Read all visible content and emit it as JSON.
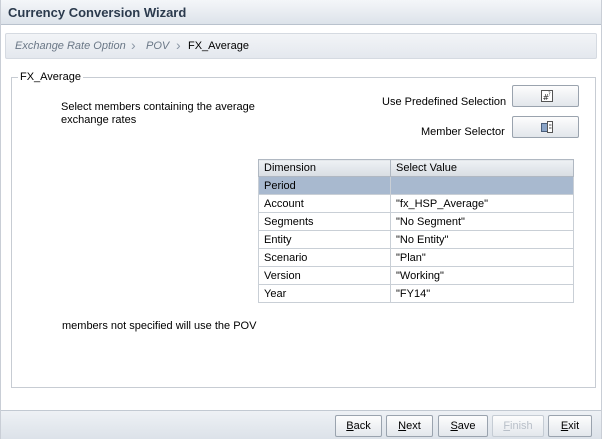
{
  "window": {
    "title": "Currency Conversion Wizard"
  },
  "breadcrumb": {
    "items": [
      "Exchange Rate Option",
      "POV"
    ],
    "current": "FX_Average"
  },
  "panel": {
    "legend": "FX_Average",
    "description": "Select members containing the average exchange rates",
    "predefined_label": "Use Predefined Selection",
    "member_selector_label": "Member Selector",
    "note": "members not specified will use the POV"
  },
  "table": {
    "headers": [
      "Dimension",
      "Select Value"
    ],
    "rows": [
      {
        "dimension": "Period",
        "value": ""
      },
      {
        "dimension": "Account",
        "value": "\"fx_HSP_Average\""
      },
      {
        "dimension": "Segments",
        "value": "\"No Segment\""
      },
      {
        "dimension": "Entity",
        "value": "\"No Entity\""
      },
      {
        "dimension": "Scenario",
        "value": "\"Plan\""
      },
      {
        "dimension": "Version",
        "value": "\"Working\""
      },
      {
        "dimension": "Year",
        "value": "\"FY14\""
      }
    ],
    "selected_row": 0
  },
  "icons": {
    "predefined": "predefined-selection-icon",
    "member_selector": "member-selector-icon",
    "breadcrumb_separator": "chevron-right-icon"
  },
  "buttons": {
    "back": {
      "first": "B",
      "rest": "ack"
    },
    "next": {
      "first": "N",
      "rest": "ext"
    },
    "save": {
      "first": "S",
      "rest": "ave"
    },
    "finish": {
      "first": "F",
      "rest": "inish"
    },
    "exit": {
      "first": "E",
      "rest": "xit"
    }
  }
}
